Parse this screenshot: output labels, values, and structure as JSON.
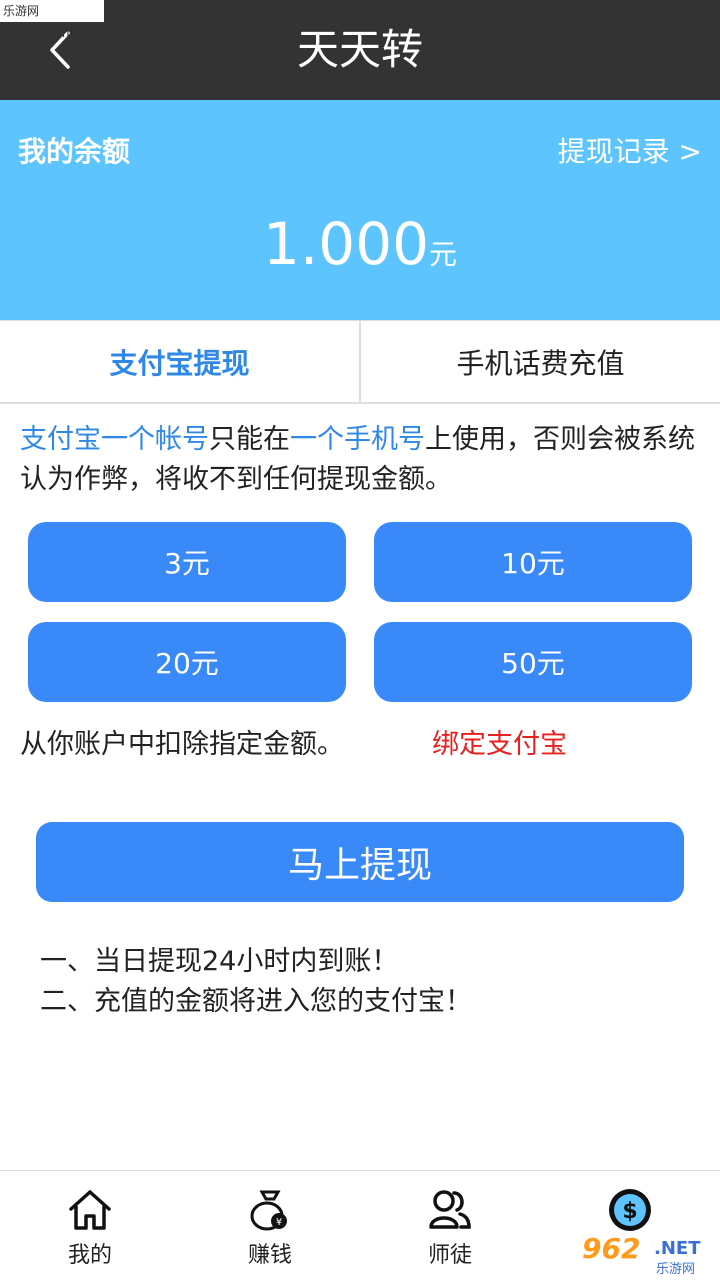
{
  "watermark": {
    "top_text": "乐游网 www.962.net",
    "brand_number": "962",
    "brand_domain": ".NET",
    "brand_cn": "乐游网"
  },
  "header": {
    "title": "天天转",
    "back_icon": "chevron-left-icon"
  },
  "balance": {
    "label": "我的余额",
    "history_link": "提现记录 >",
    "amount": "1.000",
    "unit": "元"
  },
  "tabs": [
    {
      "label": "支付宝提现",
      "active": true
    },
    {
      "label": "手机话费充值",
      "active": false
    }
  ],
  "notice": {
    "part1": "支付宝一个帐号",
    "part2": "只能在",
    "part3": "一个手机号",
    "part4": "上使用，否则会被系统认为作弊，将收不到任何提现金额。"
  },
  "amount_options": [
    "3元",
    "10元",
    "20元",
    "50元"
  ],
  "deduct_text": "从你账户中扣除指定金额。",
  "bind_link": "绑定支付宝",
  "withdraw_button": "马上提现",
  "rules": [
    "一、当日提现24小时内到账！",
    "二、充值的金额将进入您的支付宝！"
  ],
  "bottom_nav": [
    {
      "label": "我的",
      "icon": "home-icon"
    },
    {
      "label": "赚钱",
      "icon": "money-bag-icon"
    },
    {
      "label": "师徒",
      "icon": "users-icon"
    },
    {
      "label": "",
      "icon": "dollar-coin-icon"
    }
  ],
  "colors": {
    "header_bg": "#333333",
    "balance_bg": "#5ec4fe",
    "accent": "#2f88e6",
    "button": "#3a89f8",
    "warning": "#e82020"
  }
}
